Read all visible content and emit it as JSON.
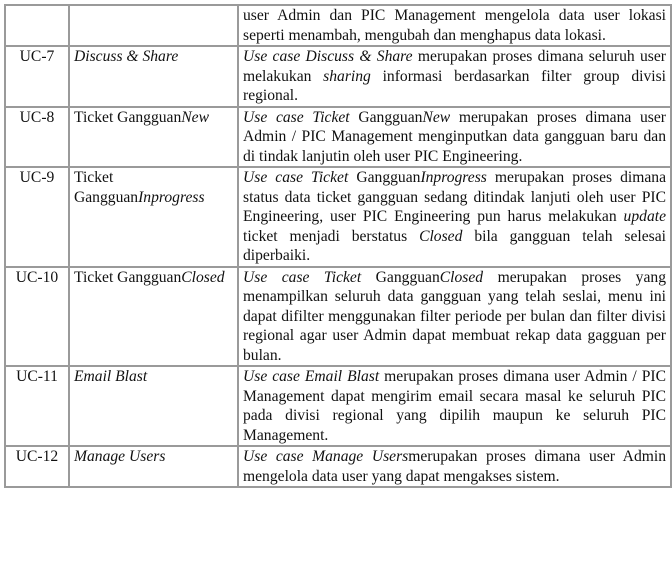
{
  "table": {
    "rows": [
      {
        "id": "",
        "name": [],
        "desc": [
          {
            "t": "user Admin dan PIC Management mengelola data user lokasi seperti menambah, mengubah dan menghapus data lokasi.",
            "i": false
          }
        ]
      },
      {
        "id": "UC-7",
        "name": [
          {
            "t": "Discuss & Share",
            "i": true
          }
        ],
        "desc": [
          {
            "t": "Use case Discuss & Share",
            "i": true
          },
          {
            "t": " merupakan proses dimana seluruh user melakukan ",
            "i": false
          },
          {
            "t": "sharing",
            "i": true
          },
          {
            "t": " informasi berdasarkan filter group divisi regional.",
            "i": false
          }
        ]
      },
      {
        "id": "UC-8",
        "name": [
          {
            "t": "Ticket Gangguan",
            "i": false
          },
          {
            "t": "New",
            "i": true
          }
        ],
        "desc": [
          {
            "t": "Use case Ticket",
            "i": true
          },
          {
            "t": " Gangguan",
            "i": false
          },
          {
            "t": "New",
            "i": true
          },
          {
            "t": " merupakan proses dimana user Admin / PIC Management menginputkan data gangguan baru dan di tindak lanjutin oleh user PIC Engineering.",
            "i": false
          }
        ]
      },
      {
        "id": "UC-9",
        "name": [
          {
            "t": "Ticket Gangguan",
            "i": false
          },
          {
            "t": "Inprogress",
            "i": true
          }
        ],
        "desc": [
          {
            "t": "Use case Ticket",
            "i": true
          },
          {
            "t": " Gangguan",
            "i": false
          },
          {
            "t": "Inprogress",
            "i": true
          },
          {
            "t": " merupakan proses dimana status data ticket gangguan sedang ditindak lanjuti oleh user PIC Engineering, user PIC Engineering pun harus melakukan ",
            "i": false
          },
          {
            "t": "update",
            "i": true
          },
          {
            "t": " ticket menjadi berstatus ",
            "i": false
          },
          {
            "t": "Closed",
            "i": true
          },
          {
            "t": " bila gangguan telah selesai diperbaiki.",
            "i": false
          }
        ]
      },
      {
        "id": "UC-10",
        "name": [
          {
            "t": "Ticket Gangguan",
            "i": false
          },
          {
            "t": "Closed",
            "i": true
          }
        ],
        "desc": [
          {
            "t": "Use case Ticket",
            "i": true
          },
          {
            "t": " Gangguan",
            "i": false
          },
          {
            "t": "Closed",
            "i": true
          },
          {
            "t": " merupakan proses yang menampilkan seluruh data gangguan yang telah seslai, menu ini dapat difilter menggunakan filter periode per bulan dan filter divisi regional agar user Admin dapat membuat rekap data gagguan per bulan.",
            "i": false
          }
        ]
      },
      {
        "id": "UC-11",
        "name": [
          {
            "t": "Email Blast",
            "i": true
          }
        ],
        "desc": [
          {
            "t": "Use case Email Blast",
            "i": true
          },
          {
            "t": " merupakan proses dimana user Admin / PIC Management dapat mengirim email secara masal ke seluruh PIC pada divisi regional yang dipilih maupun ke seluruh PIC Management.",
            "i": false
          }
        ]
      },
      {
        "id": "UC-12",
        "name": [
          {
            "t": "Manage Users",
            "i": true
          }
        ],
        "desc": [
          {
            "t": "Use case Manage Users",
            "i": true
          },
          {
            "t": "merupakan proses dimana user Admin mengelola data user yang dapat mengakses sistem.",
            "i": false
          }
        ]
      }
    ]
  }
}
